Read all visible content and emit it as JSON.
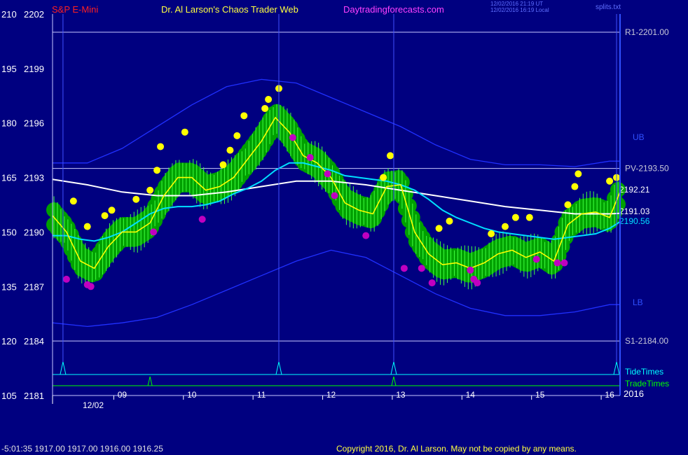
{
  "header": {
    "symbol": "S&P E-Mini",
    "site": "Dr. Al Larson's Chaos Trader Web",
    "url": "Daytradingforecasts.com",
    "timestamp_ut": "12/02/2016 21:19 UT",
    "timestamp_local": "12/02/2016 16:19 Local",
    "file": "splits.txt"
  },
  "footer": {
    "quote": "-5:01:35  1917.00 1917.00 1916.00 1916.25",
    "copyright": "Copyright 2016, Dr. Al Larson. May not be copied by any means."
  },
  "colors": {
    "background": "#000080",
    "price_ma": "#ffff00",
    "fast_ma": "#00e0ff",
    "slow_ma": "#ffffff",
    "bands": "#2030ff",
    "tide": "#00ffff",
    "trade": "#00ff00",
    "pivot_lines": "#c8c8ff",
    "bull_bubble": "#00a000",
    "high_dot": "#ffff00",
    "low_dot": "#c000c0",
    "bar": "#40ff40"
  },
  "chart_data": {
    "type": "line",
    "title": "S&P E-Mini",
    "x_labels": [
      "09",
      "10",
      "11",
      "12",
      "13",
      "14",
      "15",
      "16"
    ],
    "date_label": "12/02",
    "year_label": "2016",
    "y_ticks": [
      {
        "left": "210",
        "right": "2202"
      },
      {
        "left": "195",
        "right": "2199"
      },
      {
        "left": "180",
        "right": "2196"
      },
      {
        "left": "165",
        "right": "2193"
      },
      {
        "left": "150",
        "right": "2190"
      },
      {
        "left": "135",
        "right": "2187"
      },
      {
        "left": "120",
        "right": "2184"
      },
      {
        "left": "105",
        "right": "2181"
      }
    ],
    "ylim": [
      2181,
      2202
    ],
    "xlim": [
      8.0,
      16.15
    ],
    "levels": [
      {
        "name": "R1",
        "label": "R1-2201.00",
        "value": 2201.0
      },
      {
        "name": "PV",
        "label": "PV-2193.50",
        "value": 2193.5
      },
      {
        "name": "S1",
        "label": "S1-2184.00",
        "value": 2184.0
      }
    ],
    "band_labels": [
      "UB",
      "LB"
    ],
    "last_values": [
      {
        "label": "2192.21",
        "value": 2192.21,
        "series": "price_ma"
      },
      {
        "label": "2191.03",
        "value": 2191.03,
        "series": "slow_ma"
      },
      {
        "label": "2190.56",
        "value": 2190.56,
        "series": "fast_ma"
      }
    ],
    "markers": {
      "tide_label": "TideTimes",
      "trade_label": "TradeTimes"
    },
    "tide_times": [
      8.15,
      11.25,
      12.9,
      16.1
    ],
    "trade_times": [
      9.4,
      12.9
    ],
    "series": [
      {
        "key": "price_ma",
        "x": [
          8.0,
          8.2,
          8.4,
          8.6,
          8.8,
          9.0,
          9.2,
          9.4,
          9.6,
          9.8,
          10.0,
          10.2,
          10.4,
          10.6,
          10.8,
          11.0,
          11.2,
          11.4,
          11.6,
          11.8,
          12.0,
          12.2,
          12.4,
          12.6,
          12.8,
          13.0,
          13.2,
          13.4,
          13.6,
          13.8,
          14.0,
          14.2,
          14.4,
          14.6,
          14.8,
          15.0,
          15.2,
          15.4,
          15.6,
          15.8,
          16.0,
          16.15
        ],
        "y": [
          2190.9,
          2190.0,
          2188.4,
          2188.0,
          2189.2,
          2190.0,
          2190.0,
          2190.5,
          2192.0,
          2193.0,
          2193.0,
          2192.3,
          2192.5,
          2193.0,
          2194.0,
          2195.0,
          2196.3,
          2195.5,
          2194.2,
          2193.8,
          2193.0,
          2191.6,
          2191.2,
          2191.0,
          2192.5,
          2192.6,
          2190.0,
          2188.8,
          2188.2,
          2188.3,
          2188.0,
          2188.3,
          2188.8,
          2189.0,
          2188.6,
          2188.9,
          2188.4,
          2190.4,
          2191.0,
          2191.1,
          2190.8,
          2192.21
        ]
      },
      {
        "key": "fast_ma",
        "x": [
          8.0,
          8.2,
          8.4,
          8.6,
          8.8,
          9.0,
          9.2,
          9.4,
          9.6,
          9.8,
          10.0,
          10.2,
          10.4,
          10.6,
          10.8,
          11.0,
          11.2,
          11.4,
          11.6,
          11.8,
          12.0,
          12.2,
          12.4,
          12.6,
          12.8,
          13.0,
          13.2,
          13.4,
          13.6,
          13.8,
          14.0,
          14.2,
          14.4,
          14.6,
          14.8,
          15.0,
          15.2,
          15.4,
          15.6,
          15.8,
          16.0,
          16.15
        ],
        "y": [
          2189.8,
          2189.8,
          2189.6,
          2189.5,
          2189.7,
          2190.0,
          2190.5,
          2191.0,
          2191.3,
          2191.4,
          2191.4,
          2191.5,
          2191.7,
          2192.1,
          2192.4,
          2192.8,
          2193.4,
          2193.8,
          2193.8,
          2193.6,
          2193.4,
          2193.1,
          2193.0,
          2192.9,
          2192.8,
          2192.6,
          2192.3,
          2191.8,
          2191.2,
          2190.8,
          2190.5,
          2190.2,
          2190.0,
          2189.9,
          2189.8,
          2189.7,
          2189.6,
          2189.7,
          2189.8,
          2189.9,
          2190.2,
          2190.56
        ]
      },
      {
        "key": "slow_ma",
        "x": [
          8.0,
          8.5,
          9.0,
          9.5,
          10.0,
          10.5,
          11.0,
          11.5,
          12.0,
          12.5,
          13.0,
          13.5,
          14.0,
          14.5,
          15.0,
          15.5,
          16.0,
          16.15
        ],
        "y": [
          2192.9,
          2192.6,
          2192.2,
          2192.0,
          2192.0,
          2192.2,
          2192.5,
          2192.8,
          2192.8,
          2192.6,
          2192.3,
          2192.0,
          2191.7,
          2191.4,
          2191.2,
          2191.0,
          2191.0,
          2191.03
        ]
      },
      {
        "key": "upper_band",
        "x": [
          8.0,
          8.5,
          9.0,
          9.5,
          10.0,
          10.5,
          11.0,
          11.5,
          12.0,
          12.5,
          13.0,
          13.5,
          14.0,
          14.5,
          15.0,
          15.5,
          16.0,
          16.15
        ],
        "y": [
          2193.8,
          2193.8,
          2194.6,
          2195.8,
          2197.0,
          2198.0,
          2198.4,
          2198.2,
          2197.4,
          2196.6,
          2195.8,
          2194.8,
          2194.0,
          2193.7,
          2193.7,
          2193.6,
          2193.9,
          2193.9
        ]
      },
      {
        "key": "lower_band",
        "x": [
          8.0,
          8.5,
          9.0,
          9.5,
          10.0,
          10.5,
          11.0,
          11.5,
          12.0,
          12.5,
          13.0,
          13.5,
          14.0,
          14.5,
          15.0,
          15.5,
          16.0,
          16.15
        ],
        "y": [
          2185.0,
          2184.8,
          2185.0,
          2185.3,
          2186.0,
          2186.8,
          2187.6,
          2188.4,
          2189.0,
          2188.6,
          2187.6,
          2186.6,
          2185.8,
          2185.4,
          2185.4,
          2185.6,
          2186.0,
          2186.0
        ]
      }
    ],
    "highs": [
      [
        8.3,
        2191.7
      ],
      [
        8.5,
        2190.3
      ],
      [
        8.75,
        2190.9
      ],
      [
        8.85,
        2191.2
      ],
      [
        9.2,
        2191.8
      ],
      [
        9.4,
        2192.3
      ],
      [
        9.5,
        2193.4
      ],
      [
        9.55,
        2194.7
      ],
      [
        9.9,
        2195.5
      ],
      [
        10.45,
        2193.7
      ],
      [
        10.55,
        2194.5
      ],
      [
        10.65,
        2195.3
      ],
      [
        10.75,
        2196.4
      ],
      [
        11.05,
        2196.8
      ],
      [
        11.1,
        2197.3
      ],
      [
        11.25,
        2197.9
      ],
      [
        12.75,
        2193.0
      ],
      [
        12.85,
        2194.2
      ],
      [
        13.55,
        2190.2
      ],
      [
        13.7,
        2190.6
      ],
      [
        14.3,
        2189.9
      ],
      [
        14.5,
        2190.3
      ],
      [
        14.65,
        2190.8
      ],
      [
        14.85,
        2190.8
      ],
      [
        15.4,
        2191.5
      ],
      [
        15.5,
        2192.5
      ],
      [
        15.55,
        2193.2
      ],
      [
        16.0,
        2192.8
      ],
      [
        16.1,
        2193.0
      ]
    ],
    "lows": [
      [
        8.2,
        2187.4
      ],
      [
        8.5,
        2187.1
      ],
      [
        8.55,
        2187.0
      ],
      [
        9.45,
        2190.0
      ],
      [
        10.15,
        2190.7
      ],
      [
        11.45,
        2195.2
      ],
      [
        11.7,
        2194.1
      ],
      [
        11.95,
        2193.2
      ],
      [
        12.05,
        2192.0
      ],
      [
        12.5,
        2189.8
      ],
      [
        13.05,
        2188.0
      ],
      [
        13.3,
        2188.0
      ],
      [
        13.45,
        2187.2
      ],
      [
        14.0,
        2187.9
      ],
      [
        14.05,
        2187.4
      ],
      [
        14.1,
        2187.2
      ],
      [
        14.95,
        2188.5
      ],
      [
        15.25,
        2188.3
      ],
      [
        15.35,
        2188.3
      ]
    ]
  }
}
